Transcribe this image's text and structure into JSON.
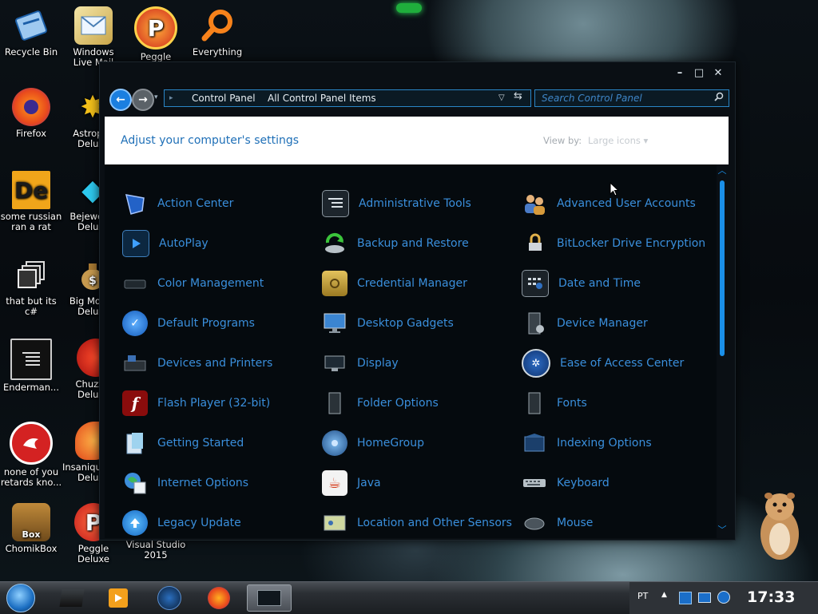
{
  "desktop": {
    "icons": [
      {
        "label": "Recycle Bin"
      },
      {
        "label": "Windows Live Mail"
      },
      {
        "label": "Peggle"
      },
      {
        "label": "Everything"
      },
      {
        "label": "Firefox"
      },
      {
        "label": "Astropop Deluxe"
      },
      {
        "label": "some russian ran a rat"
      },
      {
        "label": "Bejeweled Deluxe"
      },
      {
        "label": "that but its c#"
      },
      {
        "label": "Big Money Deluxe"
      },
      {
        "label": "Enderman..."
      },
      {
        "label": "Chuzzle Deluxe"
      },
      {
        "label": "none of you retards kno..."
      },
      {
        "label": "Insaniquarium Deluxe"
      },
      {
        "label": "ChomikBox"
      },
      {
        "label": "Peggle Deluxe"
      },
      {
        "label": "Visual Studio 2015"
      }
    ]
  },
  "window": {
    "controls": {
      "minimize": "–",
      "maximize": "□",
      "close": "✕"
    },
    "address": {
      "crumb1": "Control Panel",
      "crumb2": "All Control Panel Items"
    },
    "search": {
      "placeholder": "Search Control Panel"
    },
    "header": {
      "title": "Adjust your computer's settings",
      "view_by_label": "View by:",
      "view_by_value": "Large icons ▾"
    },
    "items": [
      {
        "label": "Action Center"
      },
      {
        "label": "Administrative Tools"
      },
      {
        "label": "Advanced User Accounts"
      },
      {
        "label": "AutoPlay"
      },
      {
        "label": "Backup and Restore"
      },
      {
        "label": "BitLocker Drive Encryption"
      },
      {
        "label": "Color Management"
      },
      {
        "label": "Credential Manager"
      },
      {
        "label": "Date and Time"
      },
      {
        "label": "Default Programs"
      },
      {
        "label": "Desktop Gadgets"
      },
      {
        "label": "Device Manager"
      },
      {
        "label": "Devices and Printers"
      },
      {
        "label": "Display"
      },
      {
        "label": "Ease of Access Center"
      },
      {
        "label": "Flash Player (32-bit)"
      },
      {
        "label": "Folder Options"
      },
      {
        "label": "Fonts"
      },
      {
        "label": "Getting Started"
      },
      {
        "label": "HomeGroup"
      },
      {
        "label": "Indexing Options"
      },
      {
        "label": "Internet Options"
      },
      {
        "label": "Java"
      },
      {
        "label": "Keyboard"
      },
      {
        "label": "Legacy Update"
      },
      {
        "label": "Location and Other Sensors"
      },
      {
        "label": "Mouse"
      }
    ]
  },
  "taskbar": {
    "language": "PT",
    "clock": "17:33"
  },
  "colors": {
    "accent": "#1a8fe8",
    "link": "#3a8fdc"
  }
}
